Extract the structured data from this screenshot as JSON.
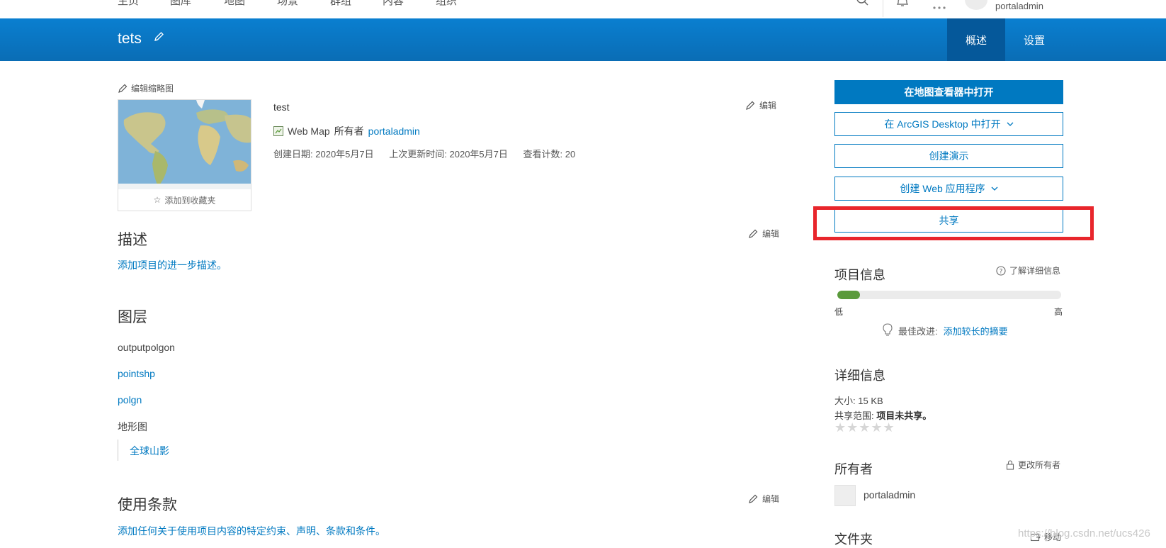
{
  "topnav": {
    "items": [
      "主页",
      "图库",
      "地图",
      "场景",
      "群组",
      "内容",
      "组织"
    ],
    "username": "portaladmin"
  },
  "header": {
    "title": "tets",
    "tabs": [
      "概述",
      "设置"
    ]
  },
  "thumbnail": {
    "edit_label": "编辑缩略图",
    "favorite_label": "添加到收藏夹"
  },
  "item": {
    "title": "test",
    "type": "Web Map",
    "owner_label": "所有者",
    "owner": "portaladmin",
    "created_label": "创建日期:",
    "created": "2020年5月7日",
    "updated_label": "上次更新时间:",
    "updated": "2020年5月7日",
    "views_label": "查看计数:",
    "views": "20",
    "edit_label": "编辑"
  },
  "description": {
    "heading": "描述",
    "placeholder": "添加项目的进一步描述。",
    "edit_label": "编辑"
  },
  "layers": {
    "heading": "图层",
    "items": [
      "outputpolgon",
      "pointshp",
      "polgn"
    ],
    "basemap_label": "地形图",
    "basemap_layer": "全球山影"
  },
  "terms": {
    "heading": "使用条款",
    "placeholder": "添加任何关于使用项目内容的特定约束、声明、条款和条件。",
    "edit_label": "编辑"
  },
  "actions": {
    "open_viewer": "在地图查看器中打开",
    "open_desktop": "在 ArcGIS Desktop 中打开",
    "create_presentation": "创建演示",
    "create_webapp": "创建 Web 应用程序",
    "share": "共享"
  },
  "item_info": {
    "heading": "项目信息",
    "learn_more": "了解详细信息",
    "progress_fraction": 0.1,
    "low": "低",
    "high": "高",
    "improve_label": "最佳改进:",
    "improve_link": "添加较长的摘要"
  },
  "details": {
    "heading": "详细信息",
    "size_label": "大小:",
    "size": "15 KB",
    "share_label": "共享范围:",
    "share_value": "项目未共享。",
    "stars": "★★★★★"
  },
  "owner_section": {
    "heading": "所有者",
    "change_label": "更改所有者",
    "name": "portaladmin"
  },
  "folder_section": {
    "heading": "文件夹",
    "move_label": "移动"
  },
  "watermark": "https://blog.csdn.net/ucs426",
  "colors": {
    "accent": "#0079c1",
    "header": "#0a72bd",
    "active_tab": "#05589a",
    "highlight": "#e8262c",
    "progress": "#5a9a3b"
  }
}
